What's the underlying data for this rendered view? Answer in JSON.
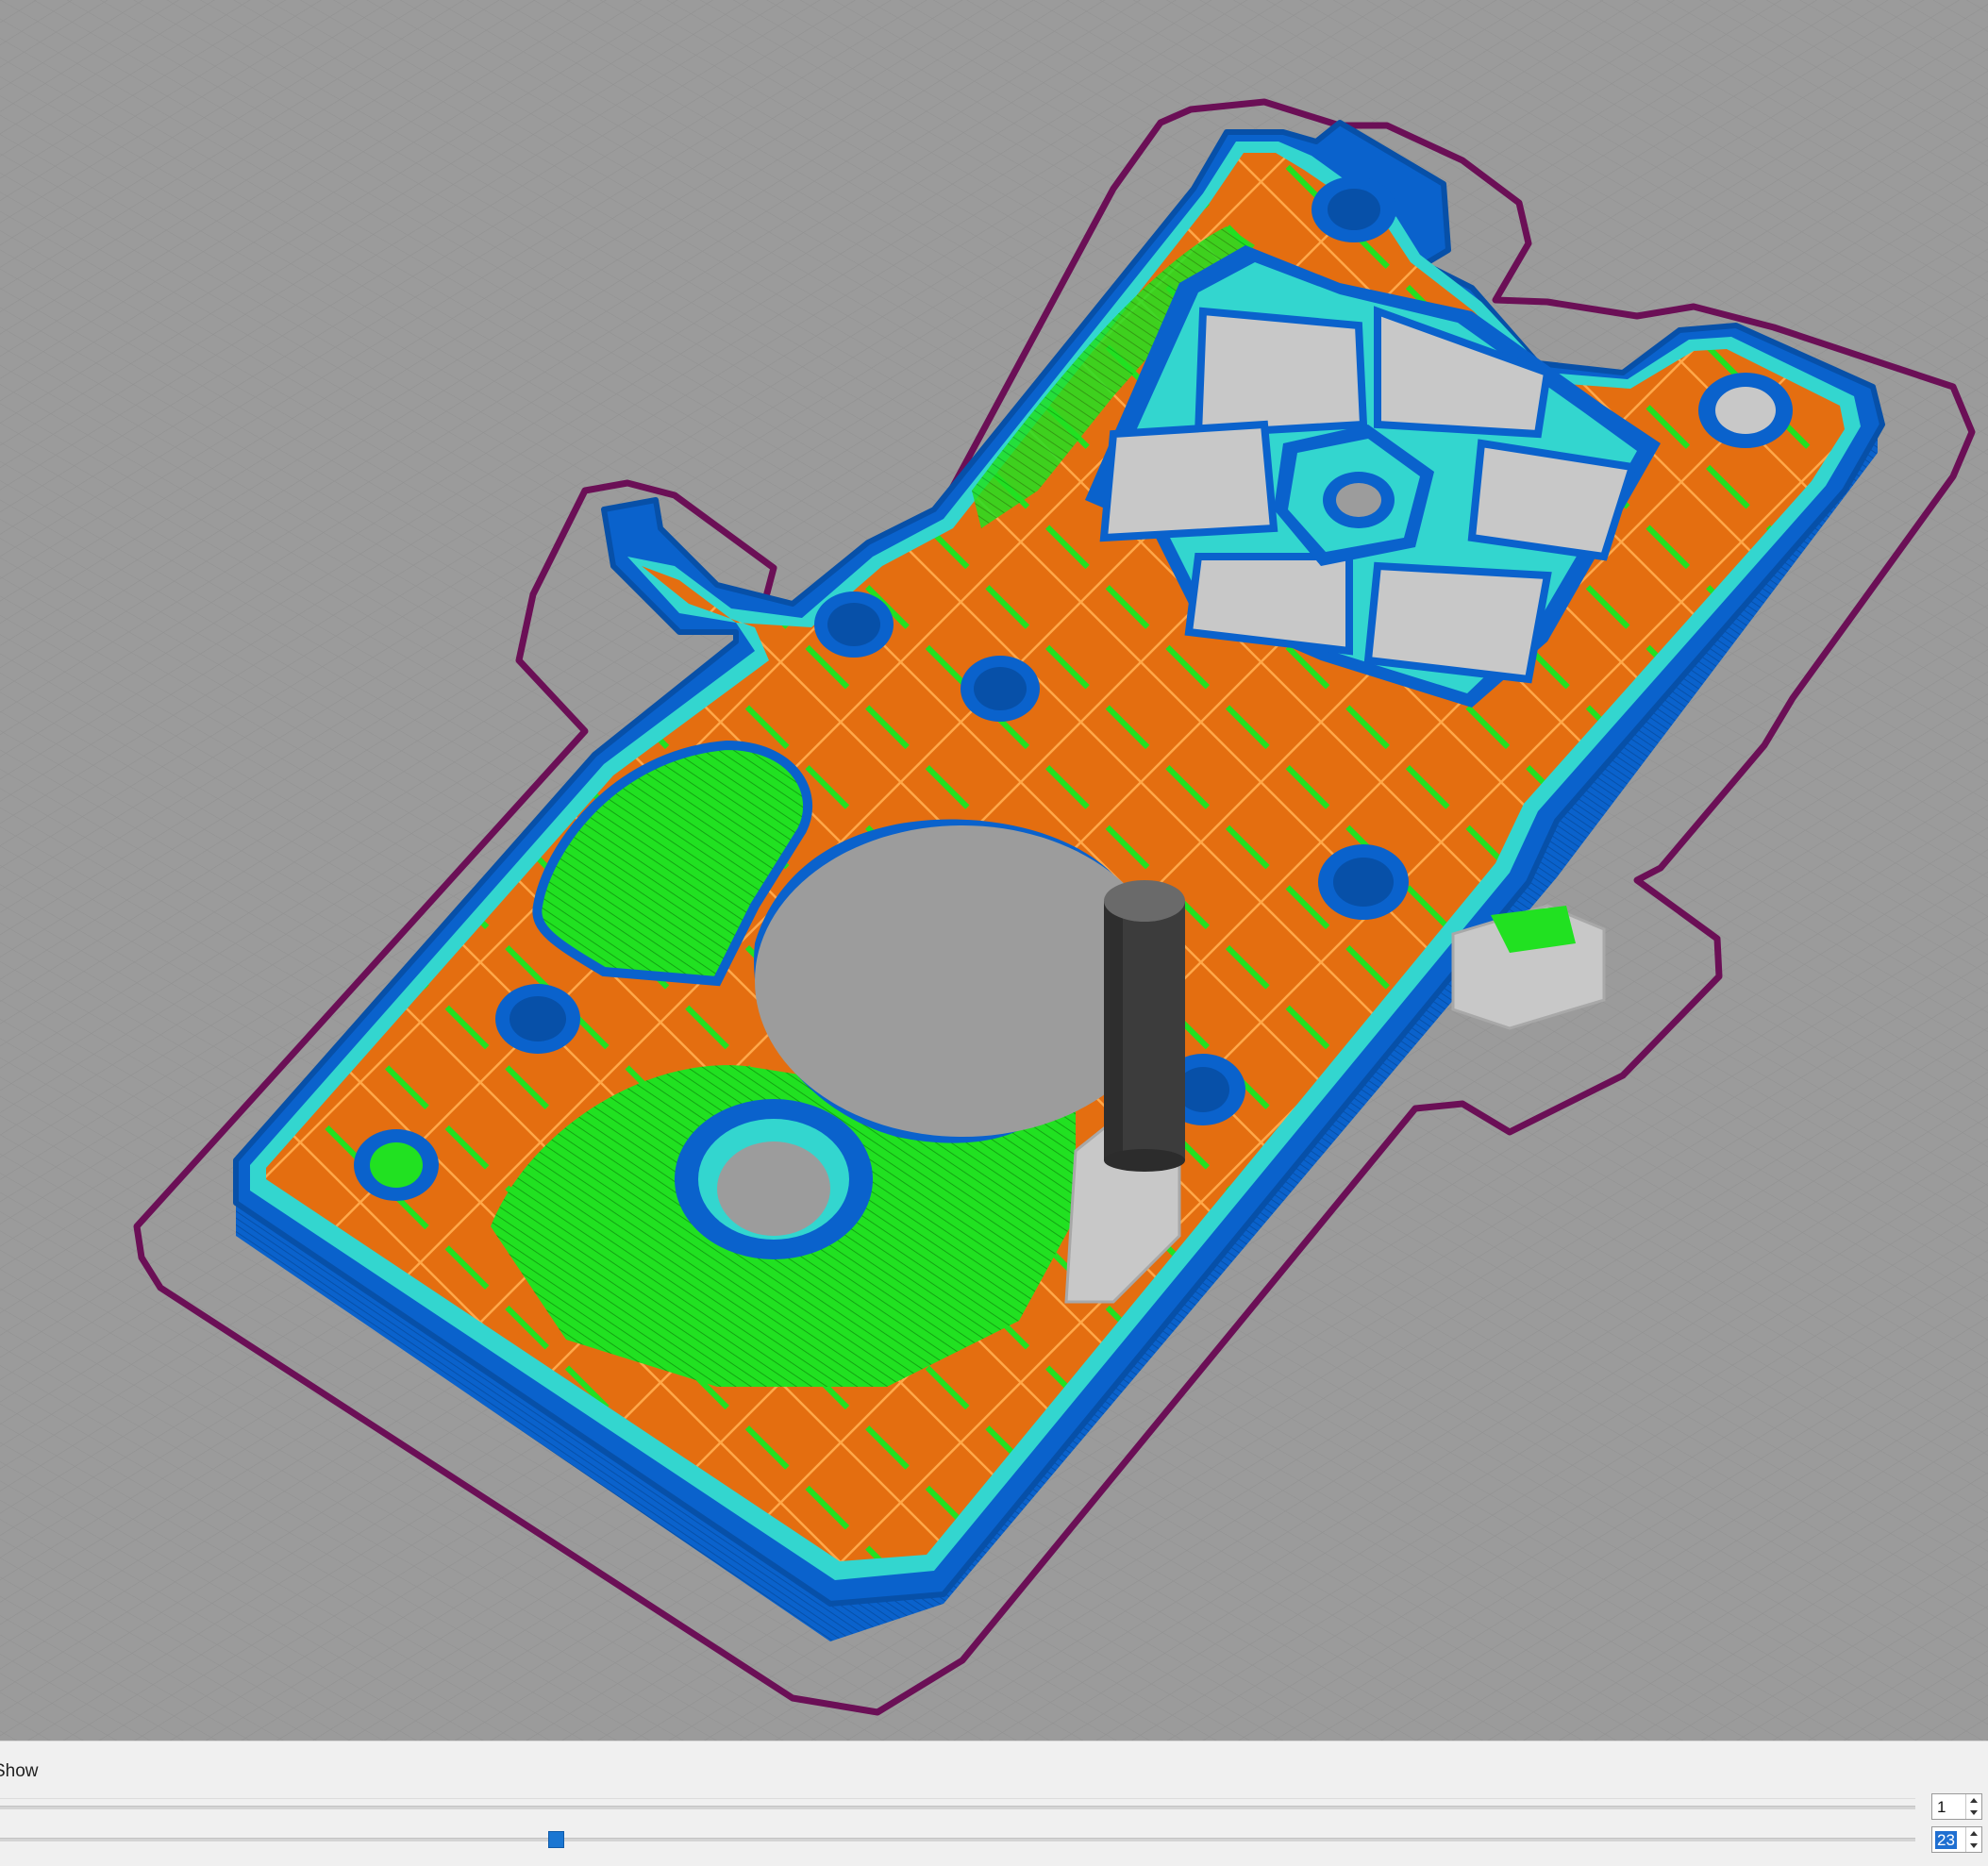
{
  "viewport": {
    "background": "#9b9b9b",
    "colors": {
      "skirt": "#6b0f56",
      "outer_wall": "#0a62cc",
      "inner_wall": "#33d6cf",
      "infill": "#e46e10",
      "solid_infill": "#21e121",
      "support": "#c8c8c8",
      "nozzle": "#3c3c3c",
      "hole": "#9c9c9c"
    }
  },
  "layer_panel": {
    "show_label": "Show",
    "min_layer": "1",
    "max_layer": "23",
    "max_layer_fraction": 0.286
  }
}
